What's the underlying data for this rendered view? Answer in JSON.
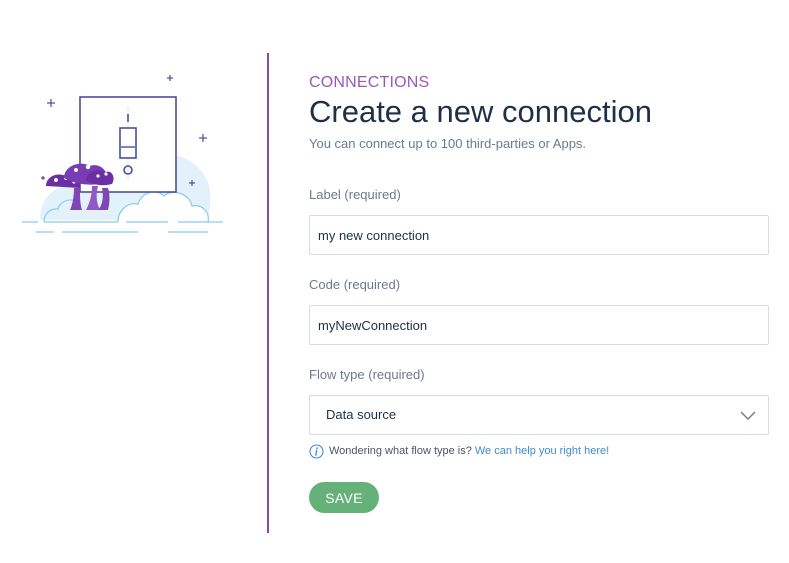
{
  "header": {
    "eyebrow": "CONNECTIONS",
    "title": "Create a new connection",
    "subtitle": "You can connect up to 100 third-parties or Apps."
  },
  "form": {
    "label_field": {
      "label": "Label (required)",
      "value": "my new connection"
    },
    "code_field": {
      "label": "Code (required)",
      "value": "myNewConnection"
    },
    "flow_type_field": {
      "label": "Flow type (required)",
      "selected": "Data source"
    },
    "help": {
      "text": "Wondering what flow type is?",
      "link": "We can help you right here!"
    },
    "save_label": "SAVE"
  },
  "icons": {
    "illustration": "light-switch-mushrooms-illustration",
    "info": "info-icon",
    "chevron": "chevron-down-icon"
  },
  "colors": {
    "accent": "#9b59b6",
    "divider": "#8a4aa3",
    "title": "#1f2f46",
    "muted": "#6b7a8f",
    "link": "#3f8bd0",
    "save_button": "#66b07a",
    "input_border": "#d6dce3"
  }
}
